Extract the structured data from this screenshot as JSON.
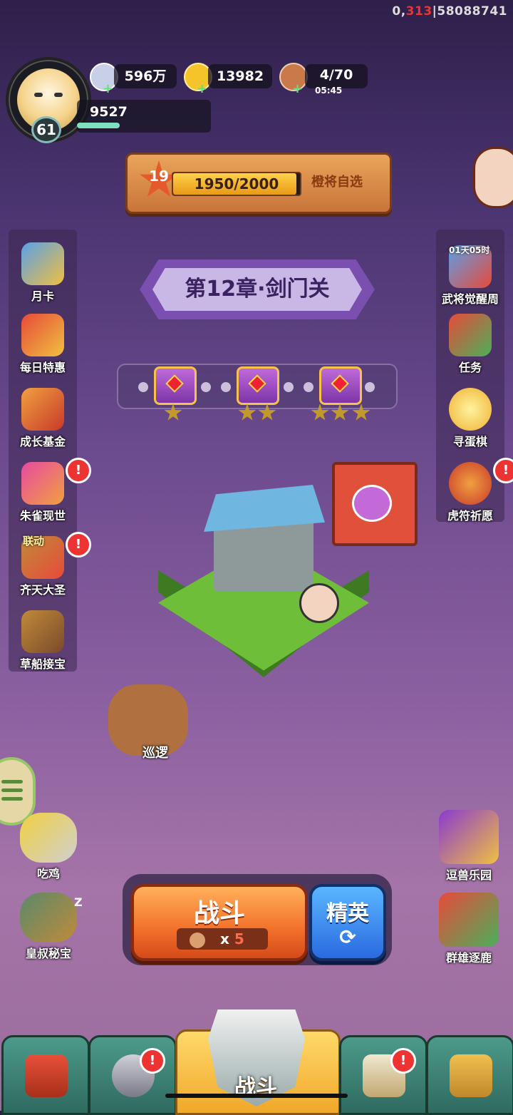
{
  "debug": {
    "prefix": "0,",
    "red": "313",
    "suffix": "|58088741"
  },
  "player": {
    "level": "61",
    "power": "9527"
  },
  "resources": {
    "silver": "596万",
    "gold": "13982",
    "stamina": "4/70",
    "stamina_timer": "05:45"
  },
  "quest": {
    "level": "19",
    "progress": "1950/2000",
    "progress_fraction": 0.975,
    "reward_label": "橙将自选"
  },
  "chapter": {
    "title": "第12章·剑门关"
  },
  "left_menu": [
    {
      "label": "月卡"
    },
    {
      "label": "每日特惠"
    },
    {
      "label": "成长基金"
    },
    {
      "label": "朱雀现世"
    },
    {
      "label": "齐天大圣",
      "tag": "联动"
    },
    {
      "label": "草船接宝"
    }
  ],
  "right_menu": [
    {
      "label": "武将觉醒周",
      "timer": "01天05时"
    },
    {
      "label": "任务"
    },
    {
      "label": "寻蛋棋"
    },
    {
      "label": "虎符祈愿"
    }
  ],
  "chest_stars": [
    1,
    2,
    3
  ],
  "patrol": {
    "label": "巡逻"
  },
  "lower_left": [
    {
      "label": "吃鸡"
    },
    {
      "label": "皇叔秘宝",
      "zz": "Z"
    }
  ],
  "lower_right": [
    {
      "label": "逗兽乐园"
    },
    {
      "label": "群雄逐鹿"
    }
  ],
  "battle": {
    "fight_label": "战斗",
    "cost_multiplier": "x",
    "cost_count": "5",
    "elite_label": "精英",
    "refresh_glyph": "⟳"
  },
  "alerts": {
    "mark": "!"
  },
  "nav": {
    "center_label": "战斗"
  },
  "colors": {
    "alert": "#e33333",
    "fight": "#f2702a",
    "elite": "#2a6ae0"
  }
}
